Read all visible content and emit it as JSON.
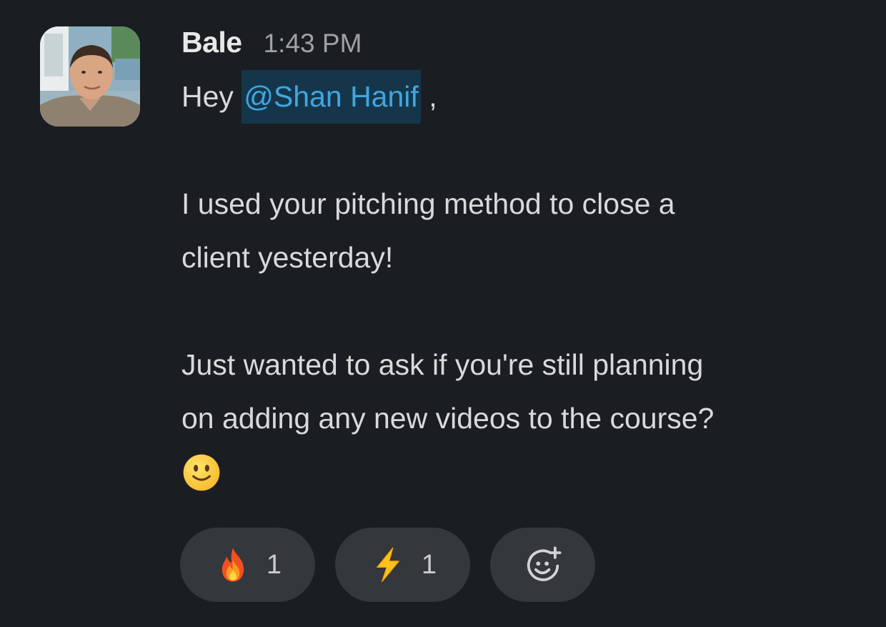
{
  "message": {
    "sender": "Bale",
    "time": "1:43 PM",
    "greeting": "Hey ",
    "mention": "@Shan Hanif",
    "after_mention": " ,",
    "paragraph1_line1": "I used your pitching method to close a",
    "paragraph1_line2": "client yesterday!",
    "paragraph2_line1": "Just wanted to ask if you're still planning",
    "paragraph2_line2": "on adding any new videos to the course?",
    "inline_emoji": "slightly-smiling-face"
  },
  "reactions": [
    {
      "emoji": "fire",
      "count": "1"
    },
    {
      "emoji": "high-voltage",
      "count": "1"
    }
  ],
  "add_reaction_icon": "add-reaction-icon",
  "colors": {
    "background": "#1a1d21",
    "mention_bg": "#15364a",
    "mention_text": "#3fa6e2",
    "reaction_bg": "#34373b"
  }
}
